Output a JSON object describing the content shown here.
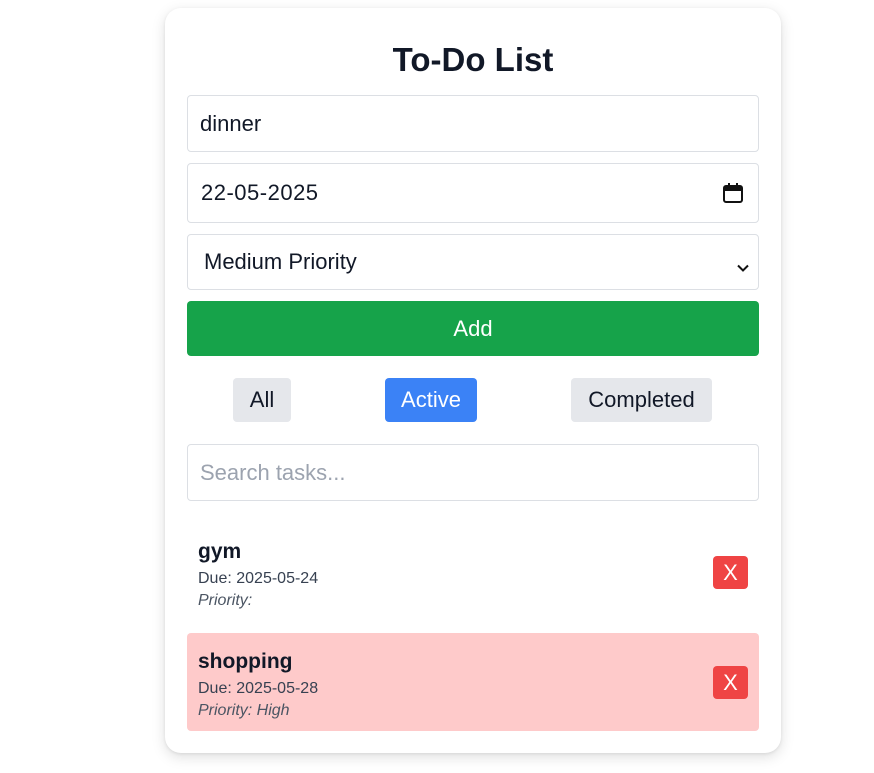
{
  "app": {
    "title": "To-Do List"
  },
  "form": {
    "task_value": "dinner",
    "date_value": "22-05-2025",
    "priority_selected": "Medium Priority",
    "add_label": "Add"
  },
  "filters": {
    "all_label": "All",
    "active_label": "Active",
    "completed_label": "Completed",
    "selected": "Active"
  },
  "search": {
    "placeholder": "Search tasks..."
  },
  "tasks": [
    {
      "name": "gym",
      "due": "Due: 2025-05-24",
      "priority": "Priority:",
      "delete_label": "X"
    },
    {
      "name": "shopping",
      "due": "Due: 2025-05-28",
      "priority": "Priority: High",
      "delete_label": "X"
    }
  ],
  "colors": {
    "add_button": "#16a34a",
    "active_filter": "#3b82f6",
    "inactive_filter": "#e5e7eb",
    "high_priority_row": "#fecaca",
    "delete_button": "#ef4444"
  },
  "icons": {
    "date_picker": "calendar-icon",
    "select_arrow": "chevron-down-icon"
  }
}
